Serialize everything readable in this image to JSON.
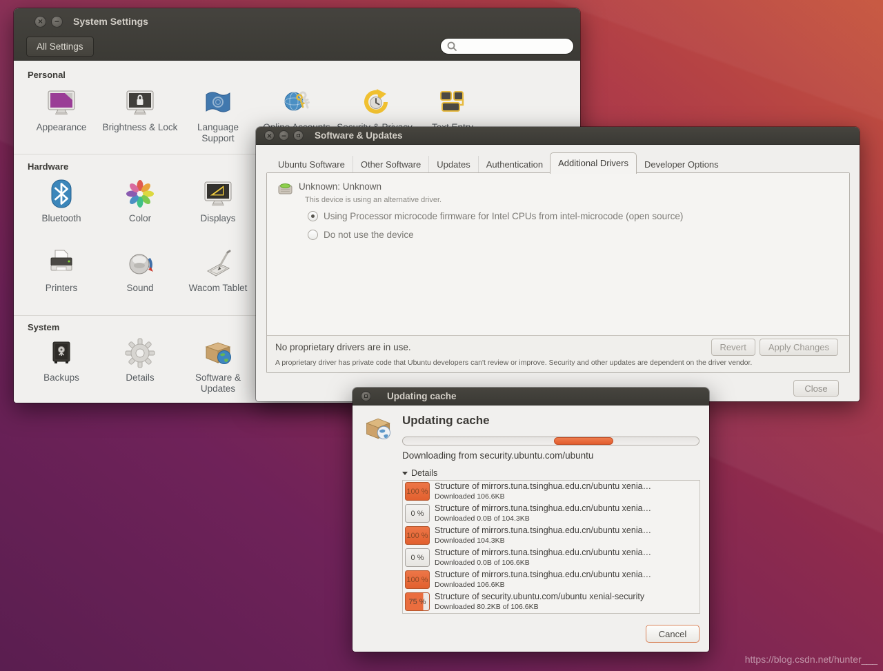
{
  "colors": {
    "accent_orange": "#e96b3c",
    "titlebar_gray": "#3c3b37",
    "window_bg": "#f1f0ee",
    "wallpaper_purple": "#5a1e50",
    "wallpaper_red": "#c44d33"
  },
  "watermark": "https://blog.csdn.net/hunter___",
  "system_settings": {
    "title": "System Settings",
    "window_buttons": [
      {
        "icon": "close-icon",
        "glyph": "×"
      },
      {
        "icon": "minimize-icon",
        "glyph": "−"
      }
    ],
    "all_settings_label": "All Settings",
    "search": {
      "placeholder": "",
      "icon": "search-icon"
    },
    "sections": [
      {
        "header": "Personal",
        "items": [
          {
            "label": "Appearance",
            "icon": "appearance-icon"
          },
          {
            "label": "Brightness & Lock",
            "icon": "brightness-lock-icon"
          },
          {
            "label": "Language Support",
            "icon": "language-support-icon"
          },
          {
            "label": "Online Accounts",
            "icon": "online-accounts-icon"
          },
          {
            "label": "Security & Privacy",
            "icon": "security-privacy-icon"
          },
          {
            "label": "Text Entry",
            "icon": "text-entry-icon"
          }
        ]
      },
      {
        "header": "Hardware",
        "items": [
          {
            "label": "Bluetooth",
            "icon": "bluetooth-icon"
          },
          {
            "label": "Color",
            "icon": "color-icon"
          },
          {
            "label": "Displays",
            "icon": "displays-icon"
          },
          {
            "label": "Printers",
            "icon": "printers-icon"
          },
          {
            "label": "Sound",
            "icon": "sound-icon"
          },
          {
            "label": "Wacom Tablet",
            "icon": "wacom-tablet-icon"
          }
        ]
      },
      {
        "header": "System",
        "items": [
          {
            "label": "Backups",
            "icon": "backups-icon"
          },
          {
            "label": "Details",
            "icon": "details-icon"
          },
          {
            "label": "Software & Updates",
            "icon": "software-updates-icon"
          }
        ]
      }
    ]
  },
  "software_updates": {
    "title": "Software & Updates",
    "window_buttons": [
      {
        "icon": "close-icon",
        "glyph": "×"
      },
      {
        "icon": "minimize-icon",
        "glyph": "−"
      },
      {
        "icon": "maximize-icon",
        "glyph": ""
      }
    ],
    "tabs": [
      {
        "label": "Ubuntu Software",
        "active": false
      },
      {
        "label": "Other Software",
        "active": false
      },
      {
        "label": "Updates",
        "active": false
      },
      {
        "label": "Authentication",
        "active": false
      },
      {
        "label": "Additional Drivers",
        "active": true
      },
      {
        "label": "Developer Options",
        "active": false
      }
    ],
    "device": {
      "name": "Unknown: Unknown",
      "status": "This device is using an alternative driver.",
      "options": [
        {
          "label": "Using Processor microcode firmware for Intel CPUs from intel-microcode (open source)",
          "selected": true
        },
        {
          "label": "Do not use the device",
          "selected": false
        }
      ]
    },
    "status_line": "No proprietary drivers are in use.",
    "revert_label": "Revert",
    "apply_label": "Apply Changes",
    "note": "A proprietary driver has private code that Ubuntu developers can't review or improve. Security and other updates are dependent on the driver vendor.",
    "close_label": "Close"
  },
  "updating_cache": {
    "title": "Updating cache",
    "window_buttons": [
      {
        "icon": "restore-icon",
        "glyph": ""
      }
    ],
    "heading": "Updating cache",
    "progress": {
      "segment_start_percent": 51,
      "segment_width_percent": 20
    },
    "status": "Downloading from security.ubuntu.com/ubuntu",
    "details_label": "Details",
    "downloads": [
      {
        "percent": "100 %",
        "fill": 100,
        "title": "Structure of mirrors.tuna.tsinghua.edu.cn/ubuntu xenia…",
        "subtitle": "Downloaded 106.6KB"
      },
      {
        "percent": "0 %",
        "fill": 0,
        "title": "Structure of mirrors.tuna.tsinghua.edu.cn/ubuntu xenia…",
        "subtitle": "Downloaded 0.0B of 104.3KB"
      },
      {
        "percent": "100 %",
        "fill": 100,
        "title": "Structure of mirrors.tuna.tsinghua.edu.cn/ubuntu xenia…",
        "subtitle": "Downloaded 104.3KB"
      },
      {
        "percent": "0 %",
        "fill": 0,
        "title": "Structure of mirrors.tuna.tsinghua.edu.cn/ubuntu xenia…",
        "subtitle": "Downloaded 0.0B of 106.6KB"
      },
      {
        "percent": "100 %",
        "fill": 100,
        "title": "Structure of mirrors.tuna.tsinghua.edu.cn/ubuntu xenia…",
        "subtitle": "Downloaded 106.6KB"
      },
      {
        "percent": "75 %",
        "fill": 75,
        "title": "Structure of security.ubuntu.com/ubuntu xenial-security",
        "subtitle": "Downloaded 80.2KB of 106.6KB"
      }
    ],
    "cancel_label": "Cancel"
  }
}
